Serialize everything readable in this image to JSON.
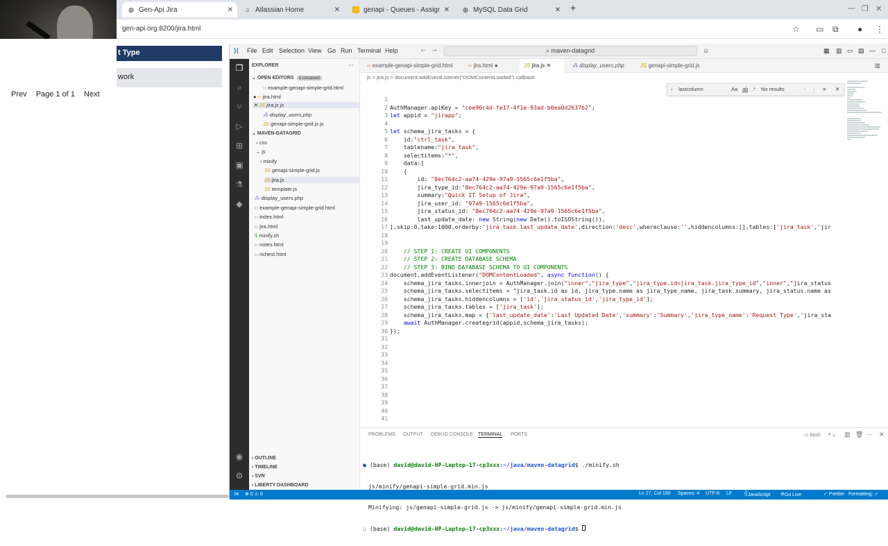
{
  "browser": {
    "tabs": [
      {
        "label": "Gen-Api Jira",
        "icon": "globe-icon",
        "active": true
      },
      {
        "label": "Atlassian Home",
        "icon": "atlassian-icon",
        "active": false
      },
      {
        "label": "genapi - Queues - Assigned t",
        "icon": "jira-icon",
        "active": false
      },
      {
        "label": "MySQL Data Grid",
        "icon": "globe-icon",
        "active": false
      }
    ],
    "url": "gen-api.org:8200/jira.html"
  },
  "page": {
    "header": "t Type",
    "subheader": "work",
    "pager": {
      "prev": "Prev",
      "info": "Page 1 of 1",
      "next": "Next"
    }
  },
  "vscode": {
    "menu": [
      "File",
      "Edit",
      "Selection",
      "View",
      "Go",
      "Run",
      "Terminal",
      "Help"
    ],
    "command_center": "maven-datagrid",
    "explorer": {
      "title": "EXPLORER",
      "open_editors_label": "OPEN EDITORS",
      "unsaved_badge": "1 unsaved",
      "open_editors": [
        "example-genapi-simple-grid.html",
        "jira.html",
        "jira.js js",
        "display_users.php",
        "genapi-simple-grid.js js"
      ],
      "project_label": "MAVEN-DATAGRID",
      "tree": [
        "css",
        "js",
        "minify",
        "genapi-simple-grid.js",
        "jira.js",
        "template.js",
        "display_users.php",
        "example-genapi-simple-grid.html",
        "index.html",
        "jira.html",
        "minify.sh",
        "notes.html",
        "richest.html"
      ],
      "bottom_sections": [
        "OUTLINE",
        "TIMELINE",
        "SVN",
        "LIBERTY DASHBOARD"
      ]
    },
    "editor_tabs": [
      "example-genapi-simple-grid.html",
      "jira.html",
      "jira.js",
      "display_users.php",
      "genapi-simple-grid.js"
    ],
    "breadcrumb": "js > jira.js > document.addEventListener(\"DOMContentLoaded\") callback",
    "find": {
      "query": "lastcolumn",
      "result": "No results",
      "opts": [
        "Aa",
        "ab",
        ".*"
      ]
    },
    "code_lines": [
      "",
      "AuthManager.apiKey = \"cee96c4d-fe17-4f1e-93ad-b0ea0d2637b2\";",
      "let appid = \"jirapp\";",
      "",
      "let schema_jira_tasks = {",
      "    id:\"ctrl_task\",",
      "    tablename:\"jira_task\",",
      "    selectitems:\"*\",",
      "    data:[",
      "    {",
      "        id: \"8ec764c2-aa74-429e-97a9-1565c6e1f5ba\",",
      "        jira_type_id:\"8ec764c2-aa74-429e-97a9-1565c6e1f5ba\",",
      "        summary:\"Quick IT Setup of Jira\",",
      "        jira_user_id: \"97a9-1565c6e1f5ba\",",
      "        jira_status_id: \"8ec764c2-aa74-429e-97a9-1565c6e1f5ba\",",
      "        last_update_date: new String(new Date().toISOString()),",
      "],skip:0,take:1000,orderby:'jira_task.last_update_date',direction:'desc',whereclause:'',hiddencolumns:[],tables:['jira_task','jir",
      "",
      "",
      "    // STEP 1: CREATE UI COMPONENTS",
      "    // STEP 2: CREATE DATABASE SCHEMA",
      "    // STEP 3: BIND DATABASE SCHEMA TO UI COMPONENTS",
      "document.addEventListener(\"DOMContentLoaded\", async function() {",
      "    schema_jira_tasks.innerjoin = AuthManager.join(\"inner\",\"jira_type\",\"jira_type.id=jira_task.jira_type_id\",\"inner\",\"jira_status",
      "    schema_jira_tasks.selectitems = \"jira_task.id as id, jira_type.name as jira_type_name, jira_task.summary, jira_status.name as",
      "    schema_jira_tasks.hiddencolumns = ['id','jira_status_id','jira_type_id'];",
      "    schema_jira_tasks.tables = ['jira_task'];",
      "    schema_jira_tasks.map = {'last_update_date':'Last Updated Date','summary':'Summary','jira_type_name':'Request Type','jira_sta",
      "    await AuthManager.creategrid(appid,schema_jira_tasks);",
      "});",
      "",
      "",
      "",
      "",
      "",
      "",
      "",
      "",
      "",
      "",
      ""
    ],
    "panel_tabs": [
      "PROBLEMS",
      "OUTPUT",
      "DEBUG CONSOLE",
      "TERMINAL",
      "PORTS"
    ],
    "terminal_shell": "bash",
    "terminal": [
      {
        "prefix": "(base) ",
        "user": "david@david-HP-Laptop-17-cp3xxx",
        "path": ":~/java/maven-datagrid",
        "cmd": "$ ./minify.sh"
      },
      {
        "text": "js/minify/genapi-simple-grid.min.js"
      },
      {
        "text": "Minifying: js/genapi-simple-grid.js -> js/minify/genapi-simple-grid.min.js"
      },
      {
        "prefix": "(base) ",
        "user": "david@david-HP-Laptop-17-cp3xxx",
        "path": ":~/java/maven-datagrid",
        "cmd": "$ "
      }
    ],
    "status": {
      "left": "⊗ 0 ⚠ 0",
      "cursor": "Ln 27, Col 150",
      "spaces": "Spaces: 4",
      "encoding": "UTF-8",
      "eol": "LF",
      "language": "JavaScript",
      "golive": "Go Live",
      "prettier": "✓ Prettier",
      "formatting": "Formatting: ✓"
    },
    "accent": "#007acc"
  }
}
